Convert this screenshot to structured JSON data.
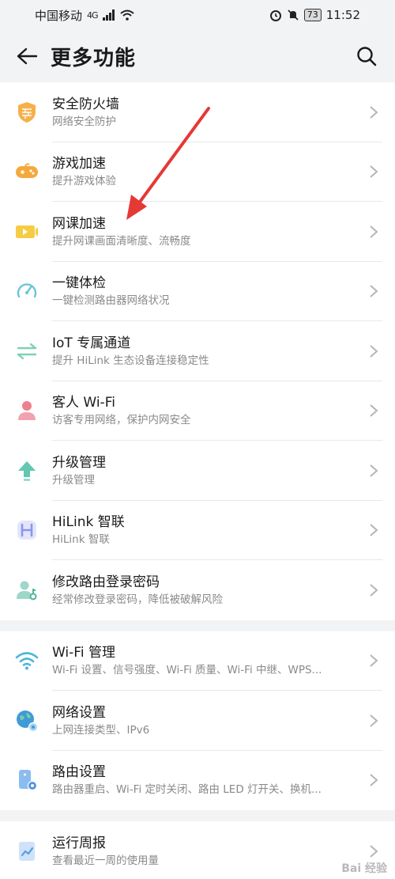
{
  "status": {
    "carrier": "中国移动",
    "network": "4G",
    "battery": "73",
    "time": "11:52"
  },
  "header": {
    "title": "更多功能"
  },
  "groups": [
    {
      "items": [
        {
          "icon": "firewall-icon",
          "title": "安全防火墙",
          "subtitle": "网络安全防护",
          "color": "#f4a93a"
        },
        {
          "icon": "gamepad-icon",
          "title": "游戏加速",
          "subtitle": "提升游戏体验",
          "color": "#f4a93a"
        },
        {
          "icon": "video-lesson-icon",
          "title": "网课加速",
          "subtitle": "提升网课画面清晰度、流畅度",
          "color": "#f4c63a"
        },
        {
          "icon": "speedometer-icon",
          "title": "一键体检",
          "subtitle": "一键检测路由器网络状况",
          "color": "#6cc4d8"
        },
        {
          "icon": "transfer-arrows-icon",
          "title": "IoT 专属通道",
          "subtitle": "提升 HiLink 生态设备连接稳定性",
          "color": "#7fd0b6"
        },
        {
          "icon": "guest-user-icon",
          "title": "客人 Wi-Fi",
          "subtitle": "访客专用网络，保护内网安全",
          "color": "#ee7f8f"
        },
        {
          "icon": "upgrade-arrow-icon",
          "title": "升级管理",
          "subtitle": "升级管理",
          "color": "#63c7b2"
        },
        {
          "icon": "hilink-icon",
          "title": "HiLink 智联",
          "subtitle": "HiLink 智联",
          "color": "#9aa6f0"
        },
        {
          "icon": "user-key-icon",
          "title": "修改路由登录密码",
          "subtitle": "经常修改登录密码，降低被破解风险",
          "color": "#7cc6b5"
        }
      ]
    },
    {
      "items": [
        {
          "icon": "wifi-icon",
          "title": "Wi-Fi 管理",
          "subtitle": "Wi-Fi 设置、信号强度、Wi-Fi 质量、Wi-Fi 中继、WPS...",
          "color": "#4cb7d8"
        },
        {
          "icon": "globe-gear-icon",
          "title": "网络设置",
          "subtitle": "上网连接类型、IPv6",
          "color": "#3f9bd8"
        },
        {
          "icon": "router-gear-icon",
          "title": "路由设置",
          "subtitle": "路由器重启、Wi-Fi 定时关闭、路由 LED 灯开关、换机...",
          "color": "#6aa8e8"
        }
      ]
    },
    {
      "items": [
        {
          "icon": "weekly-report-icon",
          "title": "运行周报",
          "subtitle": "查看最近一周的使用量",
          "color": "#6aa8e8"
        }
      ]
    }
  ],
  "colors": {
    "annotation_arrow": "#e53935",
    "chevron": "#b5b5b5"
  }
}
